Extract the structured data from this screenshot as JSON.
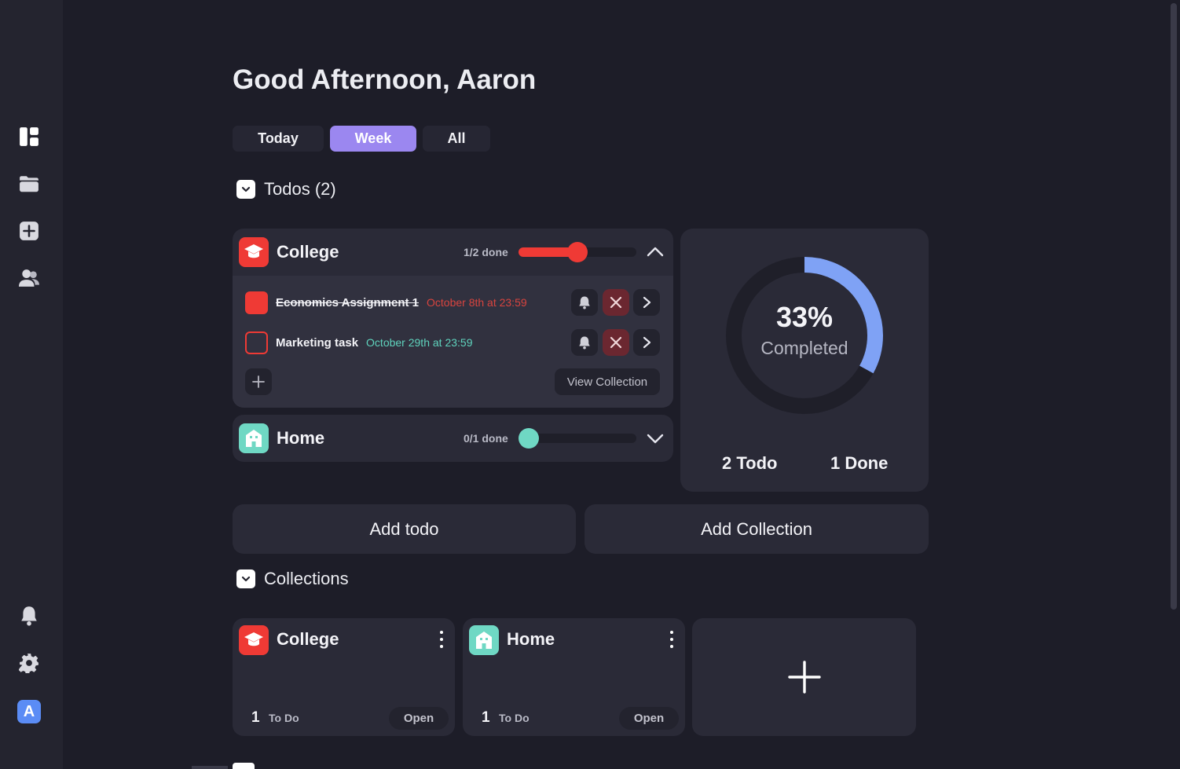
{
  "sidebar": {
    "items": [
      {
        "icon": "dashboard-icon"
      },
      {
        "icon": "folder-icon"
      },
      {
        "icon": "add-square-icon"
      },
      {
        "icon": "users-icon"
      }
    ],
    "bottom": [
      {
        "icon": "bell-icon"
      },
      {
        "icon": "gear-icon"
      }
    ],
    "avatar_letter": "A",
    "avatar_color": "#5b8cf5"
  },
  "greeting": "Good Afternoon, Aaron",
  "tabs": [
    {
      "label": "Today",
      "active": false
    },
    {
      "label": "Week",
      "active": true
    },
    {
      "label": "All",
      "active": false
    }
  ],
  "todos_section": {
    "title": "Todos (2)"
  },
  "collections_open": [
    {
      "name": "College",
      "color": "#ef3a35",
      "icon": "graduation-cap-icon",
      "done_label": "1/2 done",
      "progress": 0.5,
      "expanded": true,
      "todos": [
        {
          "name": "Economics Assignment 1",
          "date": "October 8th at 23:59",
          "done": true,
          "date_color": "#d9443f"
        },
        {
          "name": "Marketing task",
          "date": "October 29th at 23:59",
          "done": false,
          "date_color": "#5fd3bd"
        }
      ],
      "view_label": "View Collection"
    },
    {
      "name": "Home",
      "color": "#6fd8c4",
      "icon": "house-icon",
      "done_label": "0/1 done",
      "progress": 0,
      "expanded": false
    }
  ],
  "stats": {
    "percent_label": "33%",
    "completed_label": "Completed",
    "percent": 33,
    "ring_color": "#7fa2f5",
    "todo_label": "2 Todo",
    "done_label": "1 Done"
  },
  "actions": {
    "add_todo": "Add todo",
    "add_collection": "Add Collection"
  },
  "collections_section": {
    "title": "Collections"
  },
  "collection_cards": [
    {
      "name": "College",
      "color": "#ef3a35",
      "icon": "graduation-cap-icon",
      "count": "1",
      "count_label": "To Do",
      "open_label": "Open"
    },
    {
      "name": "Home",
      "color": "#6fd8c4",
      "icon": "house-icon",
      "count": "1",
      "count_label": "To Do",
      "open_label": "Open"
    }
  ]
}
